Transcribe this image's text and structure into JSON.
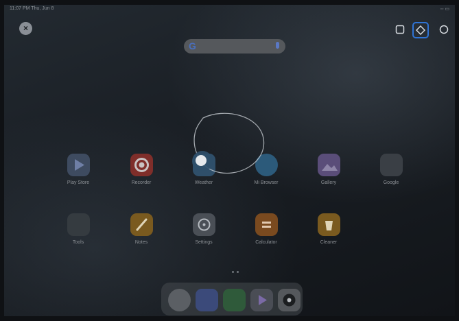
{
  "status": {
    "time_date": "11:07 PM Thu, Jun 8",
    "right": "◦◦ ▭"
  },
  "search": {
    "logo": "G",
    "icon": "mic-icon"
  },
  "tools": [
    "square-select-icon",
    "pen-icon",
    "circle-icon"
  ],
  "apps": [
    {
      "label": "Play Store",
      "color": "#3e4b60"
    },
    {
      "label": "Recorder",
      "color": "#7f2e2a"
    },
    {
      "label": "Weather",
      "color": "#2f4f6a"
    },
    {
      "label": "Mi Browser",
      "color": "#2c5a7a"
    },
    {
      "label": "Gallery",
      "color": "#5a4d79"
    },
    {
      "label": "Google",
      "color": "#3a3f45"
    },
    {
      "label": "Tools",
      "color": "#353b40"
    },
    {
      "label": "Notes",
      "color": "#7a5a1f"
    },
    {
      "label": "Settings",
      "color": "#4a4f56"
    },
    {
      "label": "Calculator",
      "color": "#7a4a1f"
    },
    {
      "label": "Cleaner",
      "color": "#7a5a1f"
    }
  ],
  "dock": [
    {
      "name": "chrome-icon",
      "color": "#5b5f64"
    },
    {
      "name": "messages-icon",
      "color": "#3b4a7a"
    },
    {
      "name": "security-icon",
      "color": "#2f5a3a"
    },
    {
      "name": "play-store-icon",
      "color": "#4a4d55"
    },
    {
      "name": "camera-icon",
      "color": "#55585c"
    }
  ],
  "colors": {
    "accent": "#2f74d6"
  }
}
